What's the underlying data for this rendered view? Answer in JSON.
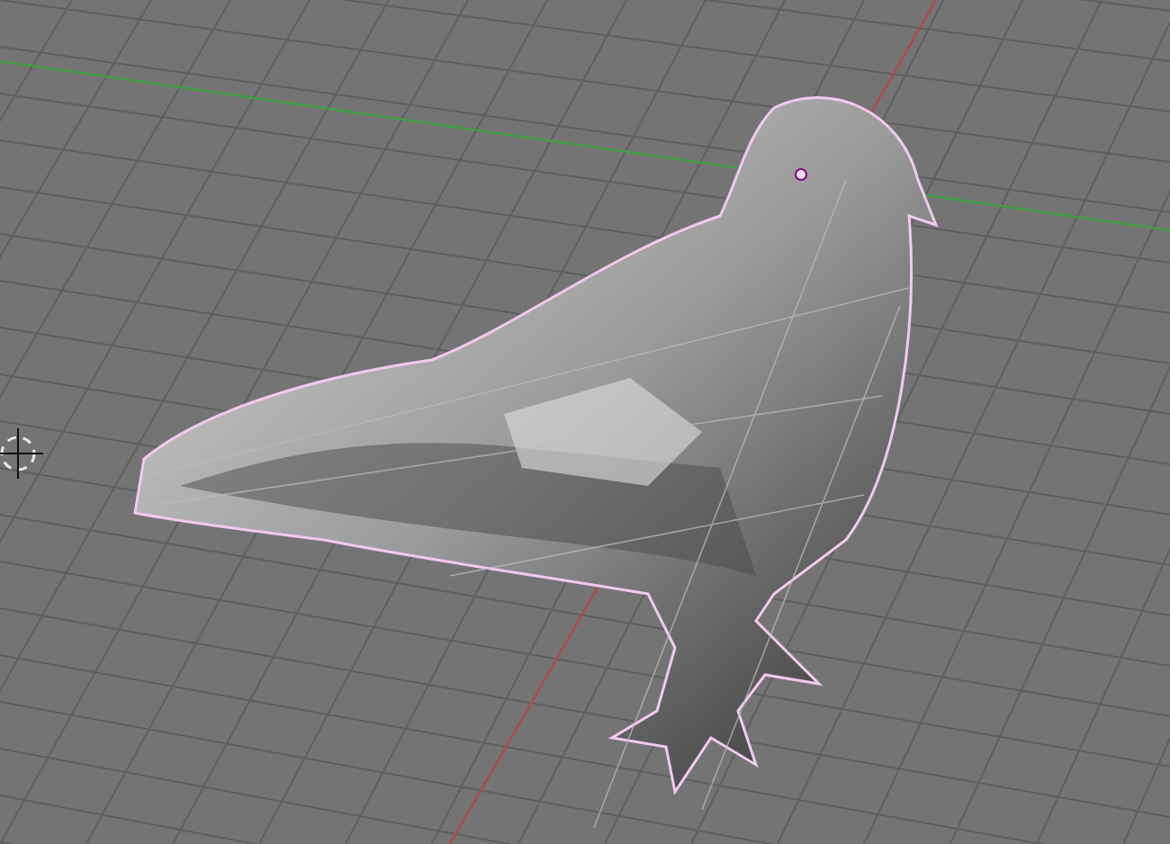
{
  "viewport": {
    "model": {
      "selected": true
    }
  }
}
